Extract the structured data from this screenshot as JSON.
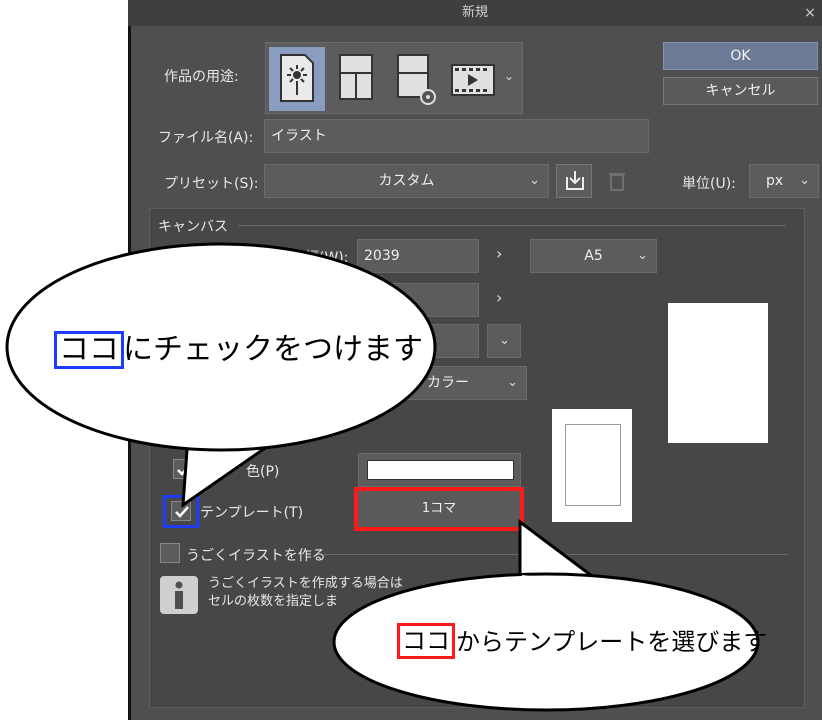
{
  "dialog": {
    "title": "新規",
    "close_glyph": "×",
    "ok_label": "OK",
    "cancel_label": "キャンセル",
    "purpose_label": "作品の用途:",
    "purpose_icons": [
      "illustration-icon",
      "comic-icon",
      "comic-settings-icon",
      "animation-icon"
    ],
    "filename_label": "ファイル名(A):",
    "filename_value": "イラスト",
    "preset_label": "プリセット(S):",
    "preset_value": "カスタム",
    "unit_label": "単位(U):",
    "unit_value": "px",
    "canvas_section": "キャンバス",
    "width_label": "幅(W):",
    "width_value": "2039",
    "size_preset": "A5",
    "color_value": "カラー",
    "paper_color_label": "色(P)",
    "template_label": "テンプレート(T)",
    "template_checked": true,
    "template_value": "1コマ",
    "animation_label": "うごくイラストを作る",
    "info_text_line1": "うごくイラストを作成する場合は",
    "info_text_line2": "セルの枚数を指定しま"
  },
  "annotations": {
    "callout1_highlight": "ココ",
    "callout1_text": "にチェックをつけます",
    "callout2_highlight": "ココ",
    "callout2_text": "からテンプレートを選びます"
  },
  "colors": {
    "dialog_bg": "#4f4f4f",
    "accent_blue": "#1e3cff",
    "accent_red": "#ff1a1a",
    "ok_button": "#6c7a96"
  }
}
